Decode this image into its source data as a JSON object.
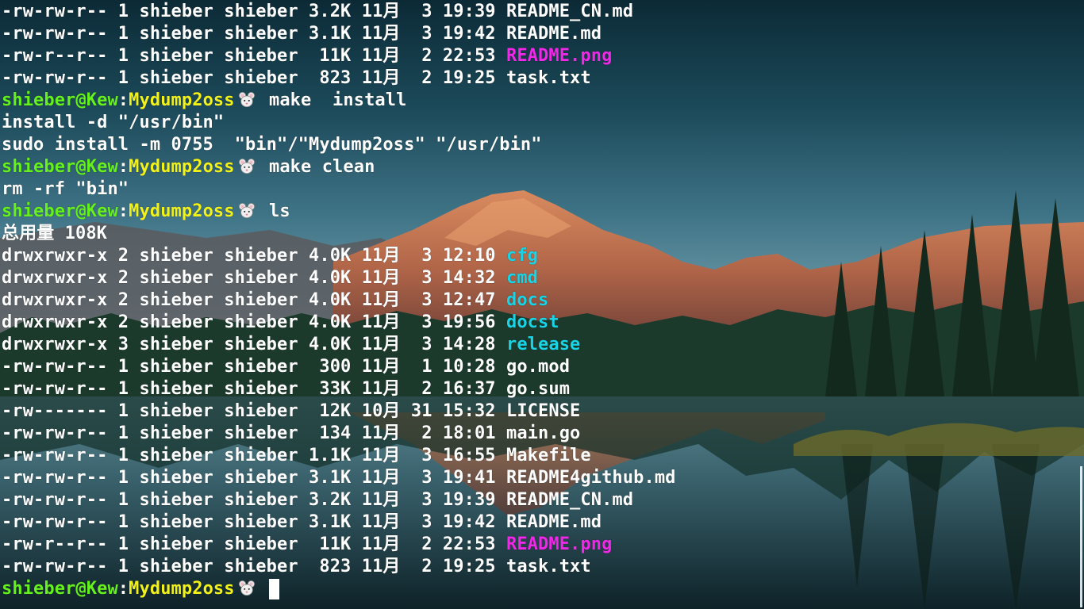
{
  "theme": {
    "dir_color": "#19d3e6",
    "image_color": "#f028e8",
    "user_color": "#66f01e",
    "path_color": "#f2f21a",
    "text_color": "#ffffff"
  },
  "prompt": {
    "user": "shieber@Kew",
    "separator": ":",
    "path": "Mydump2oss",
    "icon": "mouse-face-icon"
  },
  "lines": [
    {
      "kind": "file",
      "meta": "-rw-rw-r-- 1 shieber shieber 3.2K 11月  3 19:39 ",
      "name": "README_CN.md",
      "type": "file"
    },
    {
      "kind": "file",
      "meta": "-rw-rw-r-- 1 shieber shieber 3.1K 11月  3 19:42 ",
      "name": "README.md",
      "type": "file"
    },
    {
      "kind": "file",
      "meta": "-rw-r--r-- 1 shieber shieber  11K 11月  2 22:53 ",
      "name": "README.png",
      "type": "image"
    },
    {
      "kind": "file",
      "meta": "-rw-rw-r-- 1 shieber shieber  823 11月  2 19:25 ",
      "name": "task.txt",
      "type": "file"
    },
    {
      "kind": "prompt",
      "command": "make  install"
    },
    {
      "kind": "out",
      "text": "install -d \"/usr/bin\""
    },
    {
      "kind": "out",
      "text": "sudo install -m 0755  \"bin\"/\"Mydump2oss\" \"/usr/bin\""
    },
    {
      "kind": "prompt",
      "command": "make clean"
    },
    {
      "kind": "out",
      "text": "rm -rf \"bin\""
    },
    {
      "kind": "prompt",
      "command": "ls"
    },
    {
      "kind": "out",
      "text": "总用量 108K"
    },
    {
      "kind": "file",
      "meta": "drwxrwxr-x 2 shieber shieber 4.0K 11月  3 12:10 ",
      "name": "cfg",
      "type": "dir"
    },
    {
      "kind": "file",
      "meta": "drwxrwxr-x 2 shieber shieber 4.0K 11月  3 14:32 ",
      "name": "cmd",
      "type": "dir"
    },
    {
      "kind": "file",
      "meta": "drwxrwxr-x 2 shieber shieber 4.0K 11月  3 12:47 ",
      "name": "docs",
      "type": "dir"
    },
    {
      "kind": "file",
      "meta": "drwxrwxr-x 2 shieber shieber 4.0K 11月  3 19:56 ",
      "name": "docst",
      "type": "dir"
    },
    {
      "kind": "file",
      "meta": "drwxrwxr-x 3 shieber shieber 4.0K 11月  3 14:28 ",
      "name": "release",
      "type": "dir"
    },
    {
      "kind": "file",
      "meta": "-rw-rw-r-- 1 shieber shieber  300 11月  1 10:28 ",
      "name": "go.mod",
      "type": "file"
    },
    {
      "kind": "file",
      "meta": "-rw-rw-r-- 1 shieber shieber  33K 11月  2 16:37 ",
      "name": "go.sum",
      "type": "file"
    },
    {
      "kind": "file",
      "meta": "-rw------- 1 shieber shieber  12K 10月 31 15:32 ",
      "name": "LICENSE",
      "type": "file"
    },
    {
      "kind": "file",
      "meta": "-rw-rw-r-- 1 shieber shieber  134 11月  2 18:01 ",
      "name": "main.go",
      "type": "file"
    },
    {
      "kind": "file",
      "meta": "-rw-rw-r-- 1 shieber shieber 1.1K 11月  3 16:55 ",
      "name": "Makefile",
      "type": "file"
    },
    {
      "kind": "file",
      "meta": "-rw-rw-r-- 1 shieber shieber 3.1K 11月  3 19:41 ",
      "name": "README4github.md",
      "type": "file"
    },
    {
      "kind": "file",
      "meta": "-rw-rw-r-- 1 shieber shieber 3.2K 11月  3 19:39 ",
      "name": "README_CN.md",
      "type": "file"
    },
    {
      "kind": "file",
      "meta": "-rw-rw-r-- 1 shieber shieber 3.1K 11月  3 19:42 ",
      "name": "README.md",
      "type": "file"
    },
    {
      "kind": "file",
      "meta": "-rw-r--r-- 1 shieber shieber  11K 11月  2 22:53 ",
      "name": "README.png",
      "type": "image"
    },
    {
      "kind": "file",
      "meta": "-rw-rw-r-- 1 shieber shieber  823 11月  2 19:25 ",
      "name": "task.txt",
      "type": "file"
    },
    {
      "kind": "prompt",
      "command": "",
      "active": true
    }
  ]
}
